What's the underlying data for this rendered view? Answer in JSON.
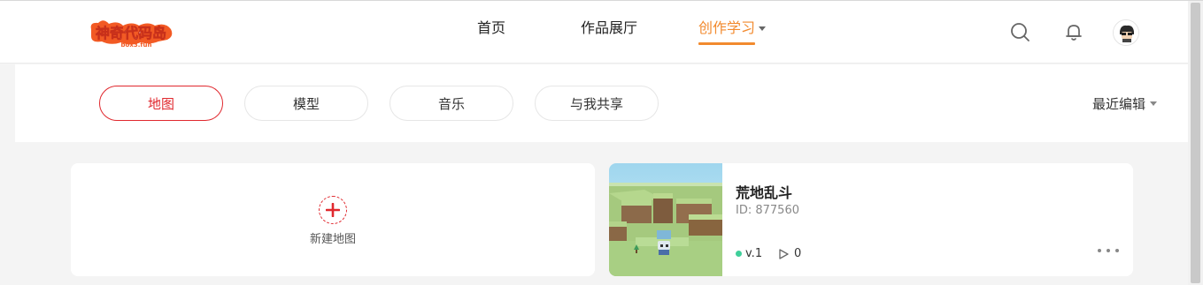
{
  "header": {
    "logo_text": "神奇代码岛",
    "logo_subtext": "box3.fun",
    "nav": [
      {
        "label": "首页"
      },
      {
        "label": "作品展厅"
      },
      {
        "label": "创作学习"
      }
    ],
    "icons": [
      "search-icon",
      "bell-icon",
      "avatar"
    ]
  },
  "filters": {
    "tabs": [
      {
        "label": "地图"
      },
      {
        "label": "模型"
      },
      {
        "label": "音乐"
      },
      {
        "label": "与我共享"
      }
    ],
    "sort_label": "最近编辑"
  },
  "new_card": {
    "label": "新建地图"
  },
  "projects": [
    {
      "title": "荒地乱斗",
      "id_text": "ID: 877560",
      "version": "v.1",
      "plays": "0"
    }
  ],
  "colors": {
    "accent_orange": "#f28a2e",
    "accent_red": "#e0282e",
    "status_green": "#3fcf9a"
  }
}
